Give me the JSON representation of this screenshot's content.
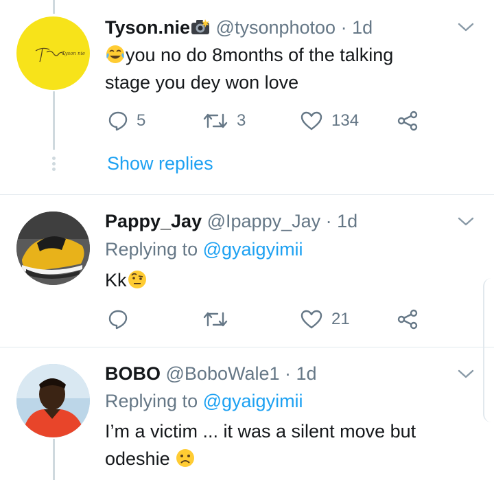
{
  "colors": {
    "accent": "#1da1f2",
    "muted": "#657786",
    "text": "#14171a",
    "divider": "#e1e8ed",
    "thread": "#cfd9de"
  },
  "tweets": [
    {
      "name": "Tyson.nie",
      "name_icon": "camera-flash-emoji",
      "handle": "@tysonphotoo",
      "time": "· 1d",
      "avatar_text": "Tyson nie",
      "text_emoji": "joy-emoji",
      "text_line1": "you no do 8months of the talking",
      "text_line2": "stage you dey won love",
      "replies": "5",
      "retweets": "3",
      "likes": "134",
      "show_replies": "Show replies"
    },
    {
      "name": "Pappy_Jay",
      "handle": "@Ipappy_Jay",
      "time": "· 1d",
      "replying_label": "Replying to",
      "replying_to": "@gyaigyimii",
      "text": "Kk",
      "text_emoji": "raised-eyebrow-emoji",
      "replies": "",
      "retweets": "",
      "likes": "21"
    },
    {
      "name": "BOBO",
      "handle": "@BoboWale1",
      "time": "· 1d",
      "replying_label": "Replying to",
      "replying_to": "@gyaigyimii",
      "text_line1": "I’m a victim ... it was a silent move but",
      "text_line2": "odeshie",
      "text_emoji": "frowning-emoji"
    }
  ]
}
